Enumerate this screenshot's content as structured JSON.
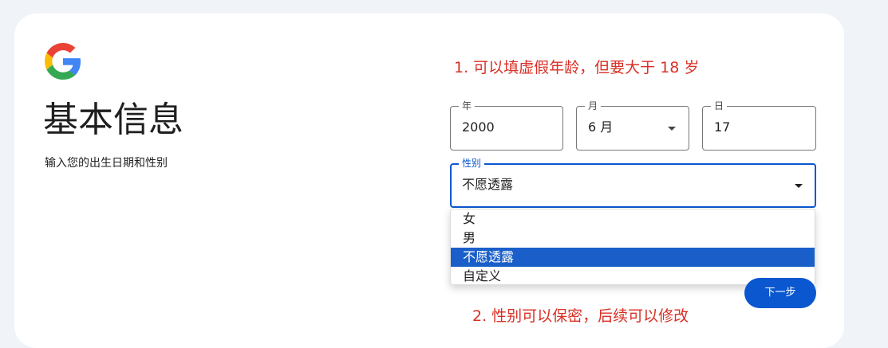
{
  "header": {
    "logo": "google-g-logo",
    "title": "基本信息",
    "subtitle": "输入您的出生日期和性别"
  },
  "annotations": {
    "note_1": "1. 可以填虚假年龄，但要大于 18 岁",
    "note_2": "2. 性别可以保密，后续可以修改",
    "color": "#d93025"
  },
  "birthday": {
    "year": {
      "label": "年",
      "value": "2000"
    },
    "month": {
      "label": "月",
      "value": "6 月"
    },
    "day": {
      "label": "日",
      "value": "17"
    }
  },
  "gender": {
    "label": "性别",
    "value": "不愿透露",
    "options": [
      {
        "label": "女",
        "selected": false
      },
      {
        "label": "男",
        "selected": false
      },
      {
        "label": "不愿透露",
        "selected": true
      },
      {
        "label": "自定义",
        "selected": false
      }
    ]
  },
  "actions": {
    "next_label": "下一步"
  },
  "colors": {
    "accent": "#0b57d0",
    "selected_option": "#1a5fc9",
    "background": "#f0f4f9"
  }
}
